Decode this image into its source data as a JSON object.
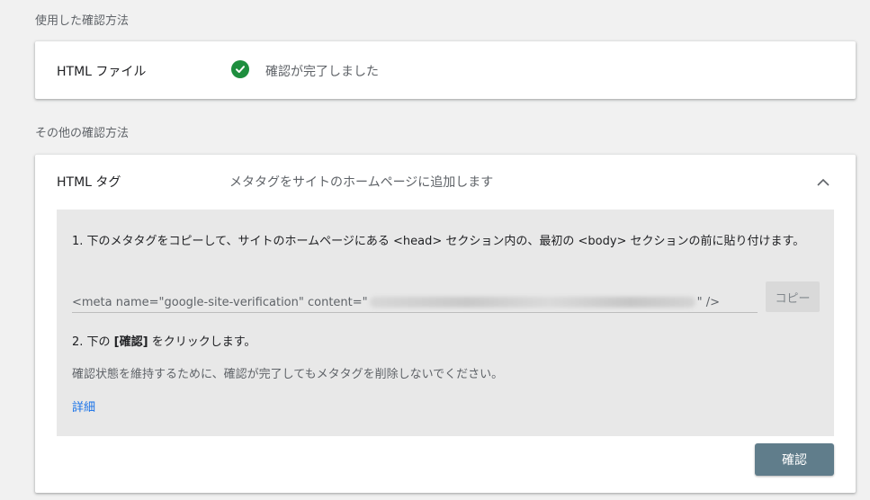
{
  "used_section": {
    "label": "使用した確認方法",
    "method": "HTML ファイル",
    "status": "確認が完了しました",
    "status_icon": "check-circle-icon",
    "status_color": "#1e8e3e"
  },
  "other_section": {
    "label": "その他の確認方法",
    "method": "HTML タグ",
    "description": "メタタグをサイトのホームページに追加します",
    "collapse_icon": "chevron-up-icon",
    "step1": "1. 下のメタタグをコピーして、サイトのホームページにある <head> セクション内の、最初の <body> セクションの前に貼り付けます。",
    "meta_prefix": "<meta name=\"google-site-verification\" content=\"",
    "meta_suffix": "\" />",
    "copy_label": "コピー",
    "step2_prefix": "2. 下の ",
    "step2_bold": "[確認]",
    "step2_suffix": " をクリックします。",
    "note": "確認状態を維持するために、確認が完了してもメタタグを削除しないでください。",
    "details_link": "詳細",
    "verify_label": "確認",
    "verify_color": "#607d8b"
  }
}
